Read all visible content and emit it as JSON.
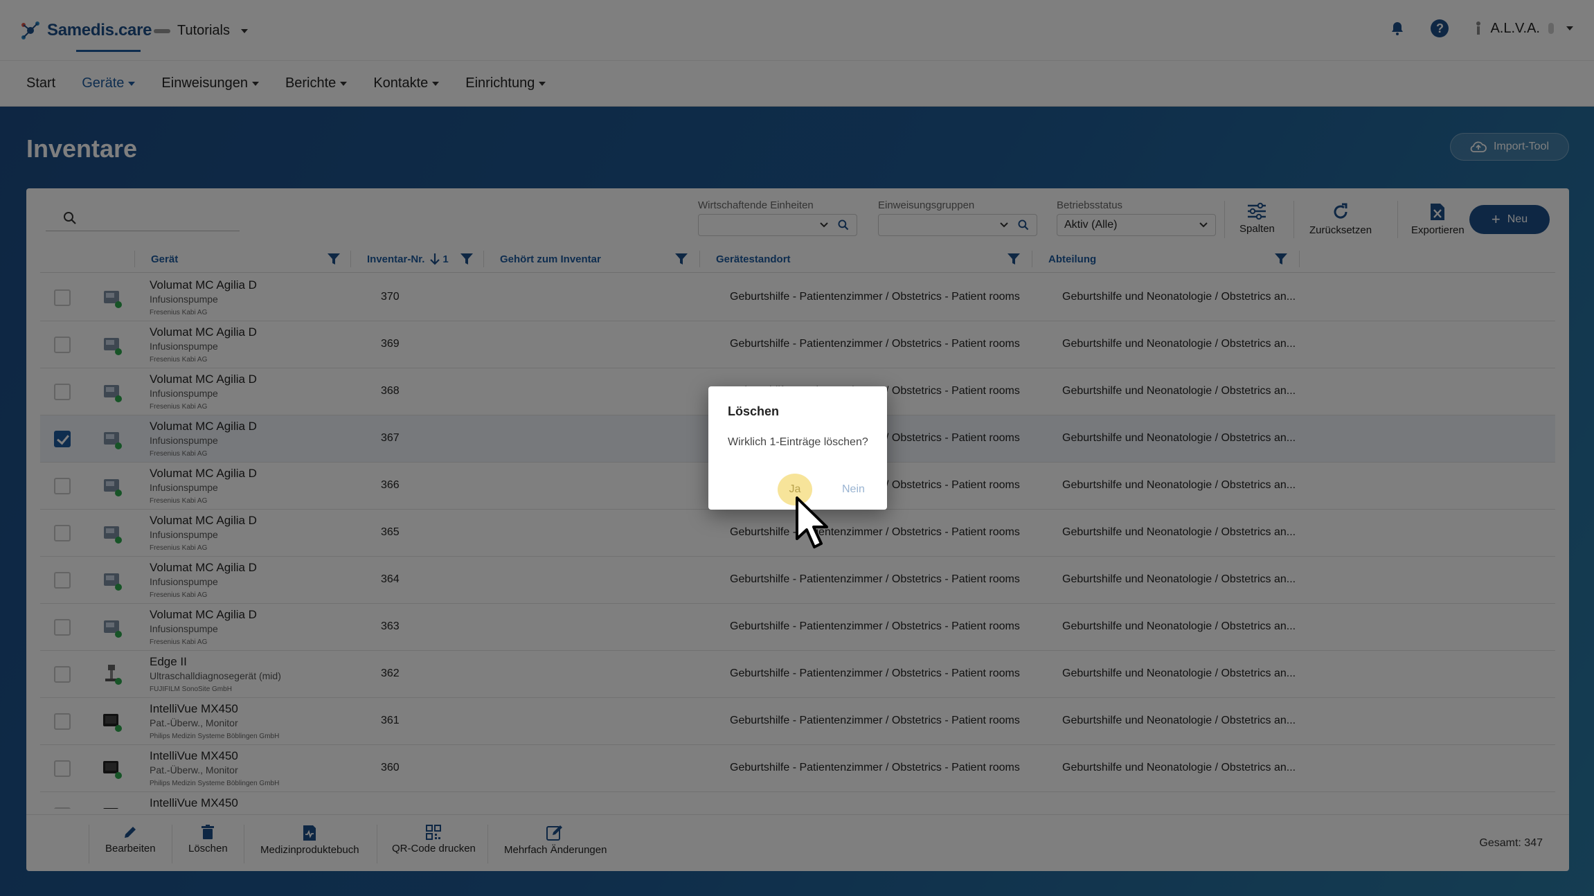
{
  "header": {
    "logo_text": "Samedis.care",
    "tenant": "Tutorials",
    "user": "A.L.V.A."
  },
  "nav": {
    "items": [
      {
        "label": "Start"
      },
      {
        "label": "Geräte"
      },
      {
        "label": "Einweisungen"
      },
      {
        "label": "Berichte"
      },
      {
        "label": "Kontakte"
      },
      {
        "label": "Einrichtung"
      }
    ]
  },
  "page": {
    "title": "Inventare",
    "import_label": "Import-Tool"
  },
  "filters": {
    "wirtschaftende_label": "Wirtschaftende Einheiten",
    "einweisungsgruppen_label": "Einweisungsgruppen",
    "betriebsstatus_label": "Betriebsstatus",
    "betriebsstatus_value": "Aktiv (Alle)"
  },
  "toolbar": {
    "spalten": "Spalten",
    "zuruecksetzen": "Zurücksetzen",
    "exportieren": "Exportieren",
    "neu": "Neu"
  },
  "table": {
    "headers": {
      "geraet": "Gerät",
      "inventar_nr": "Inventar-Nr.",
      "sort_index": "1",
      "gehoert": "Gehört zum Inventar",
      "standort": "Gerätestandort",
      "abteilung": "Abteilung"
    },
    "rows": [
      {
        "name": "Volumat MC Agilia D",
        "type": "Infusionspumpe",
        "manufacturer": "Fresenius Kabi AG",
        "inv": "370",
        "standort": "Geburtshilfe - Patientenzimmer / Obstetrics - Patient rooms",
        "abteilung": "Geburtshilfe und Neonatologie / Obstetrics an..."
      },
      {
        "name": "Volumat MC Agilia D",
        "type": "Infusionspumpe",
        "manufacturer": "Fresenius Kabi AG",
        "inv": "369",
        "standort": "Geburtshilfe - Patientenzimmer / Obstetrics - Patient rooms",
        "abteilung": "Geburtshilfe und Neonatologie / Obstetrics an..."
      },
      {
        "name": "Volumat MC Agilia D",
        "type": "Infusionspumpe",
        "manufacturer": "Fresenius Kabi AG",
        "inv": "368",
        "standort": "Geburtshilfe - Patientenzimmer / Obstetrics - Patient rooms",
        "abteilung": "Geburtshilfe und Neonatologie / Obstetrics an..."
      },
      {
        "name": "Volumat MC Agilia D",
        "type": "Infusionspumpe",
        "manufacturer": "Fresenius Kabi AG",
        "inv": "367",
        "standort": "Geburtshilfe - Patientenzimmer / Obstetrics - Patient rooms",
        "abteilung": "Geburtshilfe und Neonatologie / Obstetrics an..."
      },
      {
        "name": "Volumat MC Agilia D",
        "type": "Infusionspumpe",
        "manufacturer": "Fresenius Kabi AG",
        "inv": "366",
        "standort": "Geburtshilfe - Patientenzimmer / Obstetrics - Patient rooms",
        "abteilung": "Geburtshilfe und Neonatologie / Obstetrics an..."
      },
      {
        "name": "Volumat MC Agilia D",
        "type": "Infusionspumpe",
        "manufacturer": "Fresenius Kabi AG",
        "inv": "365",
        "standort": "Geburtshilfe - Patientenzimmer / Obstetrics - Patient rooms",
        "abteilung": "Geburtshilfe und Neonatologie / Obstetrics an..."
      },
      {
        "name": "Volumat MC Agilia D",
        "type": "Infusionspumpe",
        "manufacturer": "Fresenius Kabi AG",
        "inv": "364",
        "standort": "Geburtshilfe - Patientenzimmer / Obstetrics - Patient rooms",
        "abteilung": "Geburtshilfe und Neonatologie / Obstetrics an..."
      },
      {
        "name": "Volumat MC Agilia D",
        "type": "Infusionspumpe",
        "manufacturer": "Fresenius Kabi AG",
        "inv": "363",
        "standort": "Geburtshilfe - Patientenzimmer / Obstetrics - Patient rooms",
        "abteilung": "Geburtshilfe und Neonatologie / Obstetrics an..."
      },
      {
        "name": "Edge II",
        "type": "Ultraschalldiagnosegerät (mid)",
        "manufacturer": "FUJIFILM SonoSite GmbH",
        "inv": "362",
        "standort": "Geburtshilfe - Patientenzimmer / Obstetrics - Patient rooms",
        "abteilung": "Geburtshilfe und Neonatologie / Obstetrics an..."
      },
      {
        "name": "IntelliVue MX450",
        "type": "Pat.-Überw., Monitor",
        "manufacturer": "Philips Medizin Systeme Böblingen GmbH",
        "inv": "361",
        "standort": "Geburtshilfe - Patientenzimmer / Obstetrics - Patient rooms",
        "abteilung": "Geburtshilfe und Neonatologie / Obstetrics an..."
      },
      {
        "name": "IntelliVue MX450",
        "type": "Pat.-Überw., Monitor",
        "manufacturer": "Philips Medizin Systeme Böblingen GmbH",
        "inv": "360",
        "standort": "Geburtshilfe - Patientenzimmer / Obstetrics - Patient rooms",
        "abteilung": "Geburtshilfe und Neonatologie / Obstetrics an..."
      },
      {
        "name": "IntelliVue MX450",
        "type": "",
        "manufacturer": "",
        "inv": "",
        "standort": "",
        "abteilung": ""
      }
    ]
  },
  "actions": {
    "bearbeiten": "Bearbeiten",
    "loeschen": "Löschen",
    "medizinproduktebuch": "Medizinproduktebuch",
    "qr": "QR-Code drucken",
    "mehrfach": "Mehrfach Änderungen",
    "total": "Gesamt: 347"
  },
  "dialog": {
    "title": "Löschen",
    "text": "Wirklich 1-Einträge löschen?",
    "yes": "Ja",
    "no": "Nein"
  }
}
